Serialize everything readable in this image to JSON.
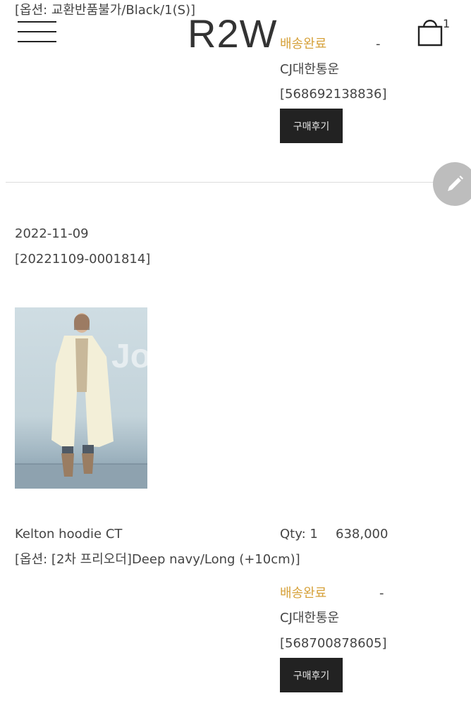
{
  "header": {
    "logo": "R2W",
    "cart_count": "1"
  },
  "order_prev": {
    "option_text": "[옵션: 교환반품불가/Black/1(S)]",
    "status": "배송완료",
    "dash": "-",
    "courier": "CJ대한통운",
    "tracking": "[568692138836]",
    "review_label": "구매후기"
  },
  "order": {
    "date": "2022-11-09",
    "order_number": "[20221109-0001814]",
    "product_name": "Kelton hoodie CT",
    "qty": "Qty: 1",
    "price": "638,000",
    "option_text": "[옵션: [2차 프리오더]Deep navy/Long (+10cm)]",
    "status": "배송완료",
    "dash": "-",
    "courier": "CJ대한통운",
    "tracking": "[568700878605]",
    "review_label": "구매후기",
    "image_watermark": "Jo"
  },
  "icons": {
    "menu": "hamburger-icon",
    "cart": "shopping-bag-icon",
    "edit": "pencil-icon"
  }
}
